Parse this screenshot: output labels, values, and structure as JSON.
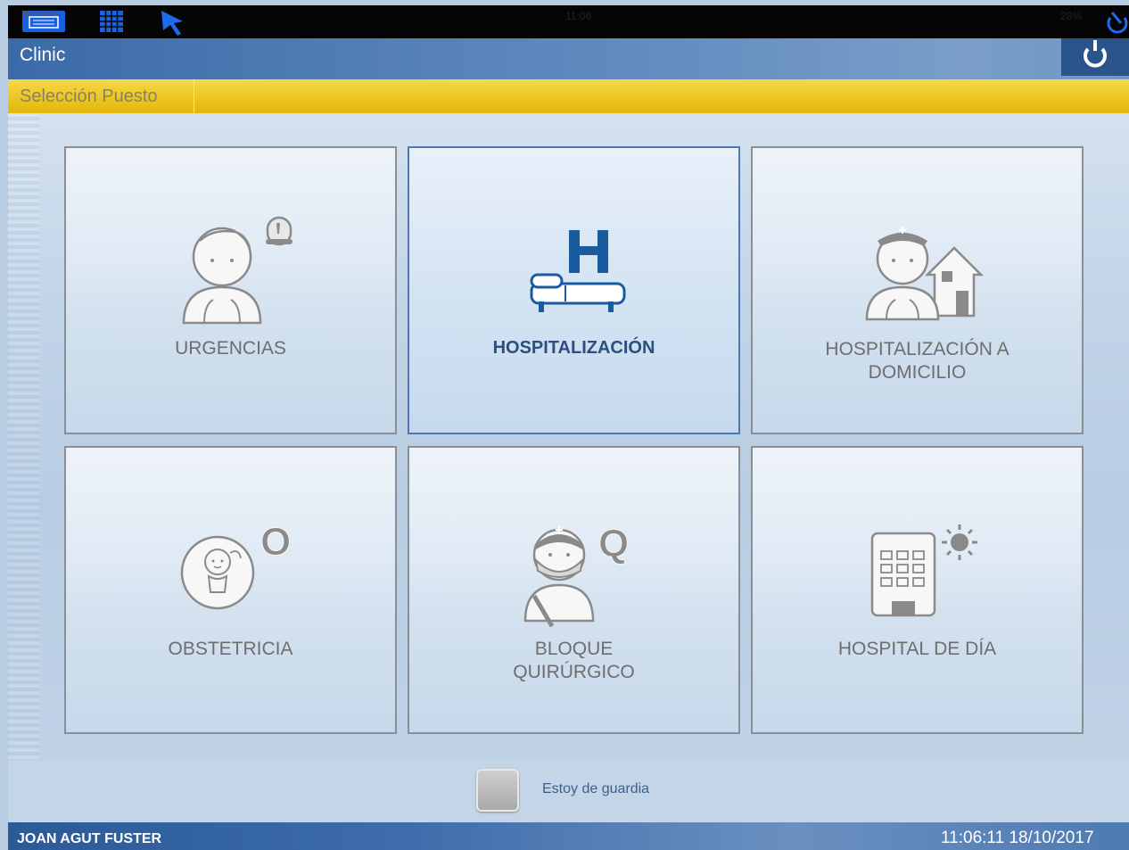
{
  "system_bar": {
    "keyboard_label": "Teclado",
    "clock": "11:06",
    "right_text": "28%"
  },
  "app": {
    "title": "Clinic"
  },
  "breadcrumb": {
    "label": "Selección Puesto"
  },
  "tiles": [
    {
      "label": "URGENCIAS",
      "icon": "person-with-siren-icon"
    },
    {
      "label": "HOSPITALIZACIÓN",
      "icon": "hospital-bed-icon",
      "badge": "H",
      "selected": true
    },
    {
      "label_line1": "HOSPITALIZACIÓN A",
      "label_line2": "DOMICILIO",
      "icon": "nurse-with-house-icon"
    },
    {
      "label": "OBSTETRICIA",
      "icon": "baby-icon",
      "badge": "O"
    },
    {
      "label_line1": "BLOQUE",
      "label_line2": "QUIRÚRGICO",
      "icon": "surgeon-icon",
      "badge": "Q"
    },
    {
      "label": "HOSPITAL DE DÍA",
      "icon": "building-with-sun-icon"
    }
  ],
  "on_call": {
    "label": "Estoy de guardia",
    "checked": false
  },
  "status_bar": {
    "user": "JOAN AGUT FUSTER",
    "datetime": "11:06:11  18/10/2017"
  },
  "colors": {
    "title_bar": "#4e7ab2",
    "breadcrumb": "#ecc41f",
    "active_label": "#2c4f80",
    "icon_blue": "#1a5a9e"
  }
}
